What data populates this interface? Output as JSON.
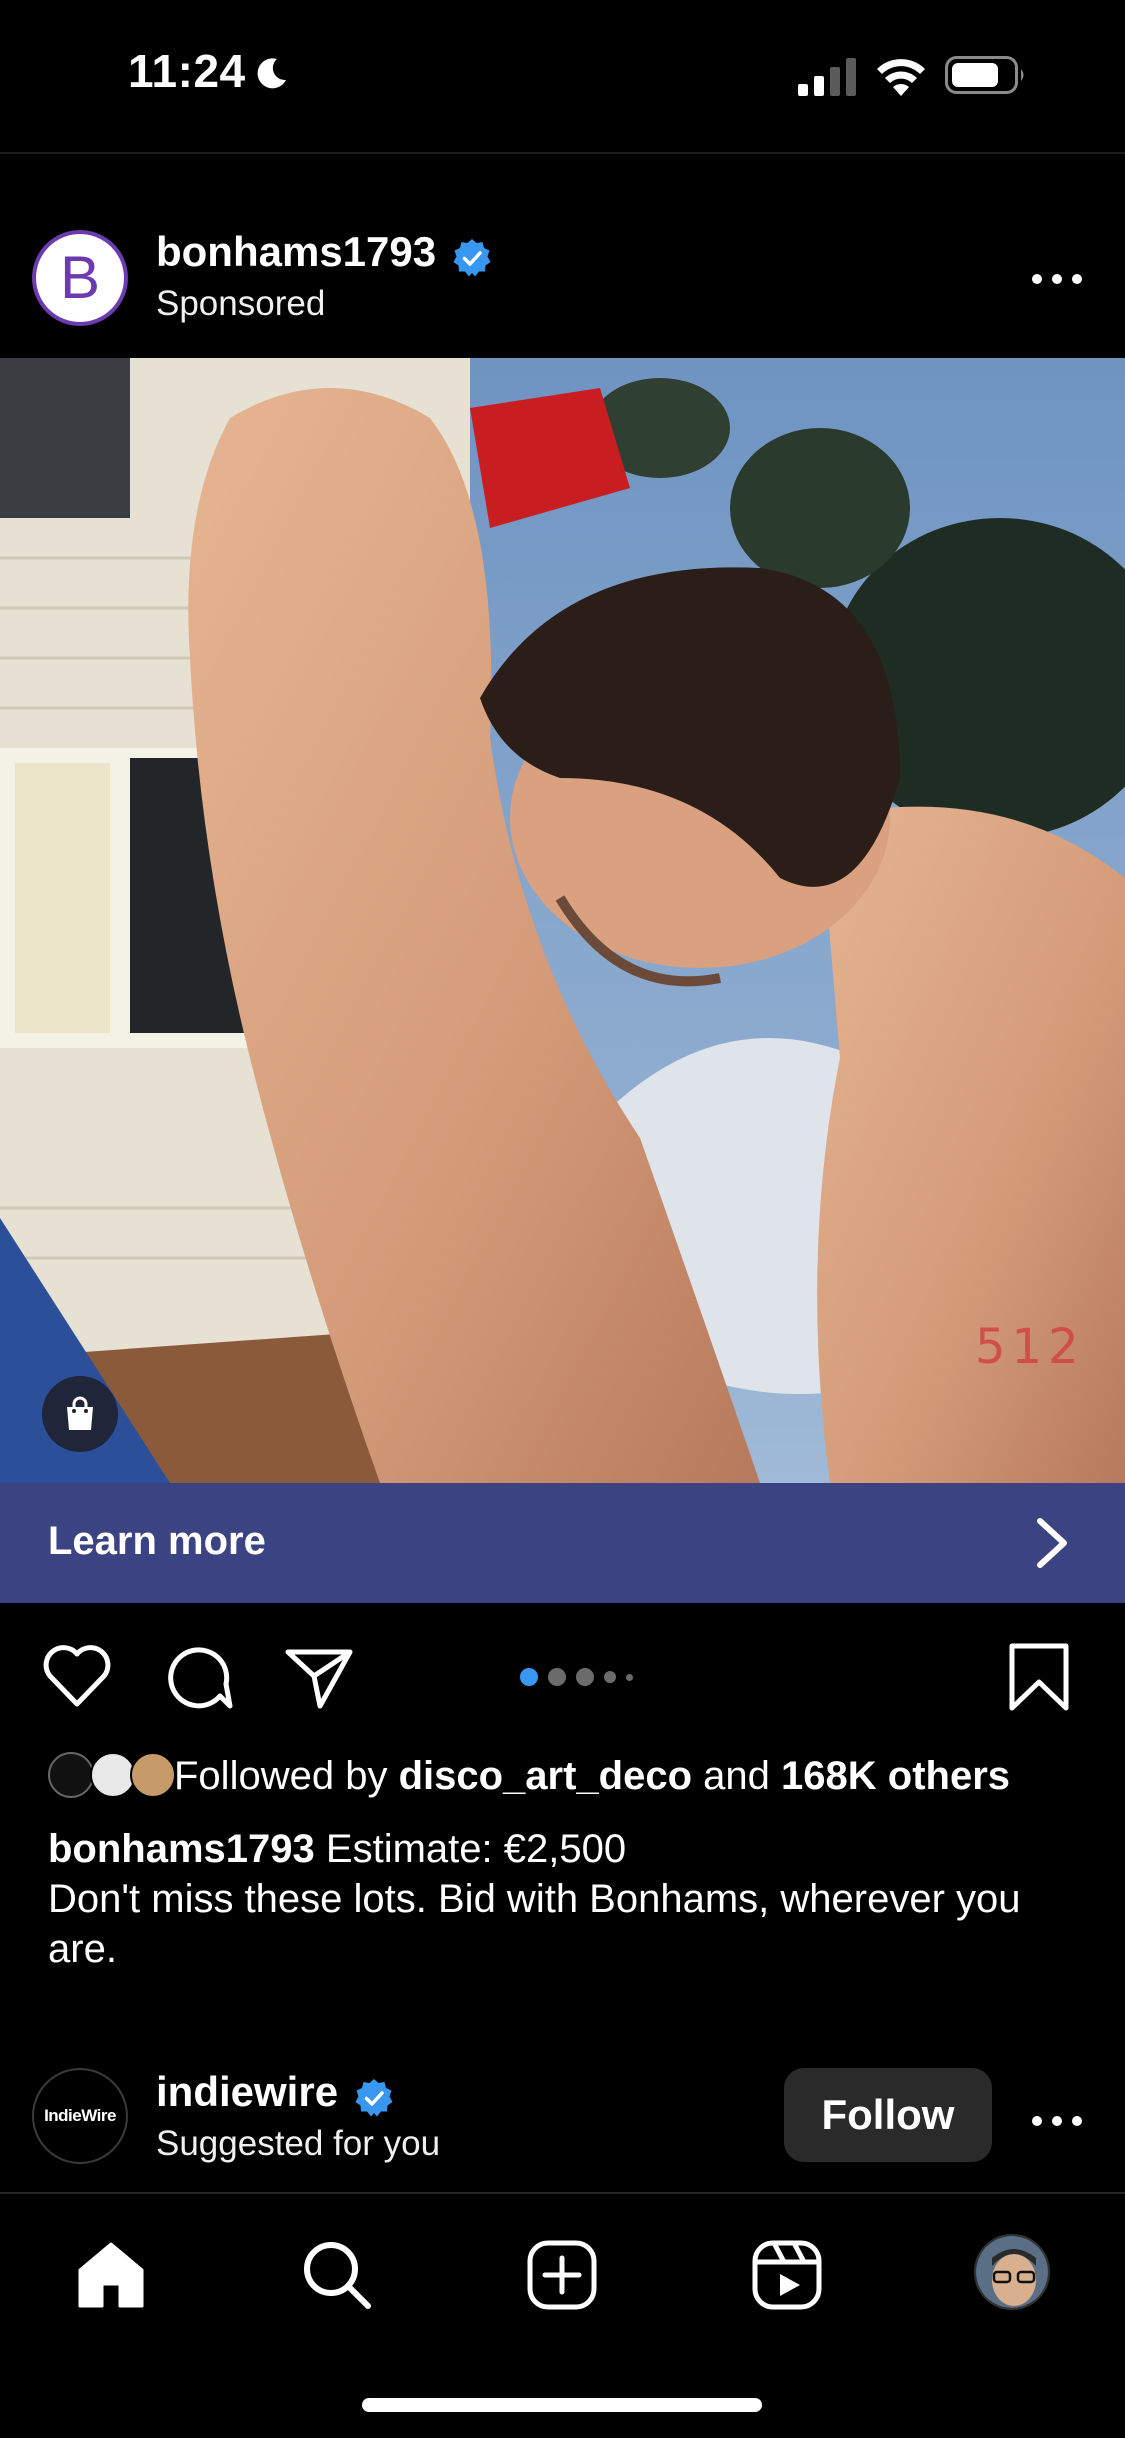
{
  "status_bar": {
    "time": "11:24",
    "icons": [
      "moon-icon",
      "signal-icon",
      "wifi-icon",
      "battery-icon"
    ]
  },
  "post": {
    "username": "bonhams1793",
    "avatar_letter": "B",
    "subtitle": "Sponsored",
    "verified": true,
    "cta_label": "Learn more",
    "carousel": {
      "count": 5,
      "active_index": 1
    },
    "media_overlay_text": "512",
    "followed_by": {
      "prefix": "Followed by",
      "user": "disco_art_deco",
      "middle": "and",
      "others": "168K others"
    },
    "caption": {
      "username": "bonhams1793",
      "estimate": "Estimate: €2,500",
      "body": "Don't miss these lots. Bid with Bonhams, wherever you are."
    }
  },
  "suggested": {
    "username": "indiewire",
    "avatar_text": "IndieWire",
    "subtitle": "Suggested for you",
    "follow_label": "Follow"
  },
  "tabbar": {
    "items": [
      "home-icon",
      "search-icon",
      "create-icon",
      "reels-icon",
      "profile-avatar"
    ]
  },
  "colors": {
    "cta_bg": "#3b4382",
    "verified": "#3897f0",
    "carousel_active": "#3897f0",
    "background": "#000000"
  }
}
